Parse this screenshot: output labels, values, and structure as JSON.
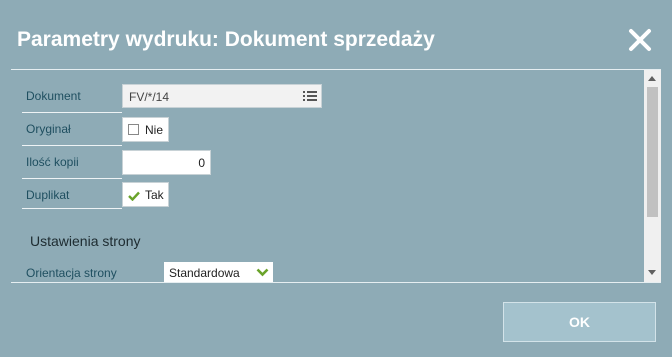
{
  "dialog": {
    "title": "Parametry wydruku: Dokument sprzedaży",
    "close_icon": "close-icon"
  },
  "form": {
    "dokument": {
      "label": "Dokument",
      "value": "FV/*/14",
      "icon": "list-icon"
    },
    "oryginal": {
      "label": "Oryginał",
      "checked": false,
      "value_text": "Nie"
    },
    "ilosc_kopii": {
      "label": "Ilość kopii",
      "value": "0"
    },
    "duplikat": {
      "label": "Duplikat",
      "checked": true,
      "value_text": "Tak",
      "icon": "checkmark-icon"
    }
  },
  "page_settings": {
    "title": "Ustawienia strony",
    "orientation": {
      "label": "Orientacja strony",
      "value": "Standardowa",
      "icon": "chevron-down-icon"
    }
  },
  "footer": {
    "ok_label": "OK"
  },
  "colors": {
    "background": "#8eabb6",
    "label_text": "#1f4f60",
    "accent_green": "#6aa32a",
    "ok_button": "#a4c2cd"
  }
}
